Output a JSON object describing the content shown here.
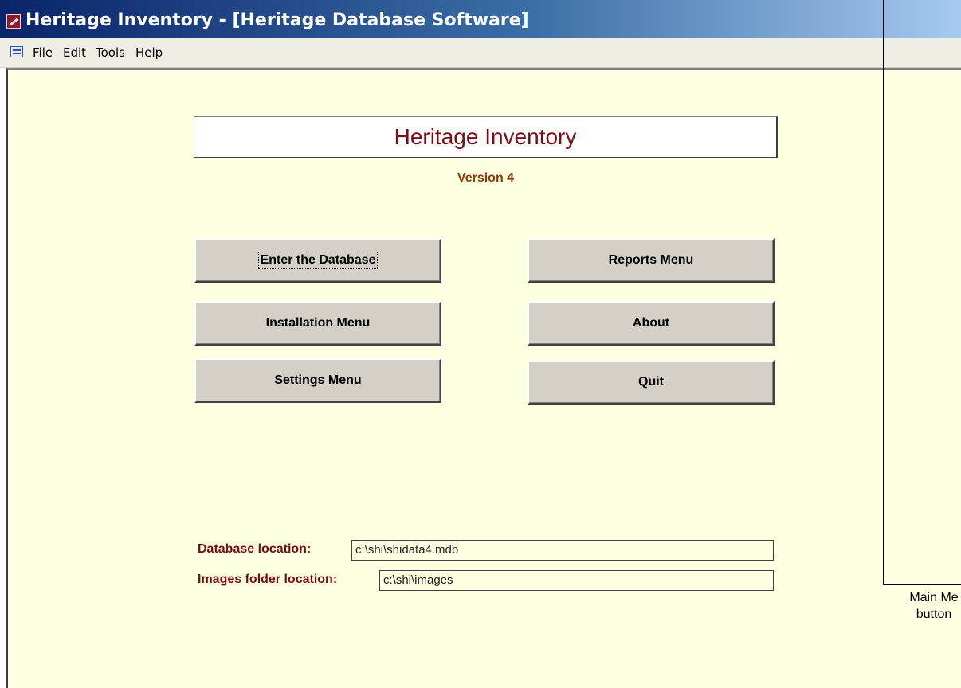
{
  "window": {
    "title": "Heritage Inventory - [Heritage Database Software]"
  },
  "menubar": {
    "items": [
      {
        "label": "File"
      },
      {
        "label": "Edit"
      },
      {
        "label": "Tools"
      },
      {
        "label": "Help"
      }
    ]
  },
  "main": {
    "heading": "Heritage Inventory",
    "version": "Version 4",
    "buttons": {
      "enter_database": "Enter the Database",
      "reports_menu": "Reports Menu",
      "installation_menu": "Installation Menu",
      "about": "About",
      "settings_menu": "Settings Menu",
      "quit": "Quit"
    },
    "database_location": {
      "label": "Database location:",
      "value": "c:\\shi\\shidata4.mdb"
    },
    "images_location": {
      "label": "Images folder location:",
      "value": "c:\\shi\\images"
    }
  },
  "annotation": {
    "text_line1": "Main Me",
    "text_line2": "button"
  },
  "colors": {
    "form_background": "#ffffe1",
    "heading_color": "#7a0d14",
    "version_color": "#8a3a00",
    "button_face": "#d4d0c8"
  }
}
